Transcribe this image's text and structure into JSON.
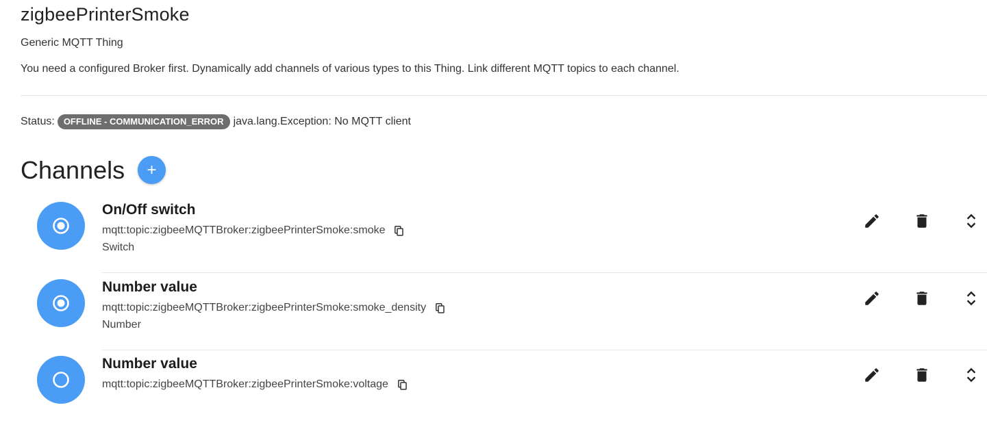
{
  "thing": {
    "name": "zigbeePrinterSmoke",
    "type_label": "Generic MQTT Thing",
    "description": "You need a configured Broker first. Dynamically add channels of various types to this Thing. Link different MQTT topics to each channel."
  },
  "status": {
    "label": "Status:",
    "badge": "OFFLINE - COMMUNICATION_ERROR",
    "detail": "java.lang.Exception: No MQTT client",
    "badge_color": "#6e6e6e"
  },
  "channels": {
    "title": "Channels",
    "add_icon": "plus-icon",
    "accent_color": "#4a9cf4",
    "items": [
      {
        "label": "On/Off switch",
        "uid": "mqtt:topic:zigbeeMQTTBroker:zigbeePrinterSmoke:smoke",
        "type": "Switch",
        "icon": "radio-checked-icon"
      },
      {
        "label": "Number value",
        "uid": "mqtt:topic:zigbeeMQTTBroker:zigbeePrinterSmoke:smoke_density",
        "type": "Number",
        "icon": "radio-checked-icon"
      },
      {
        "label": "Number value",
        "uid": "mqtt:topic:zigbeeMQTTBroker:zigbeePrinterSmoke:voltage",
        "type": "",
        "icon": "radio-unchecked-icon"
      }
    ]
  },
  "icons": {
    "edit": "pencil-icon",
    "delete": "trash-icon",
    "expand": "unfold-more-icon",
    "copy": "copy-icon"
  }
}
